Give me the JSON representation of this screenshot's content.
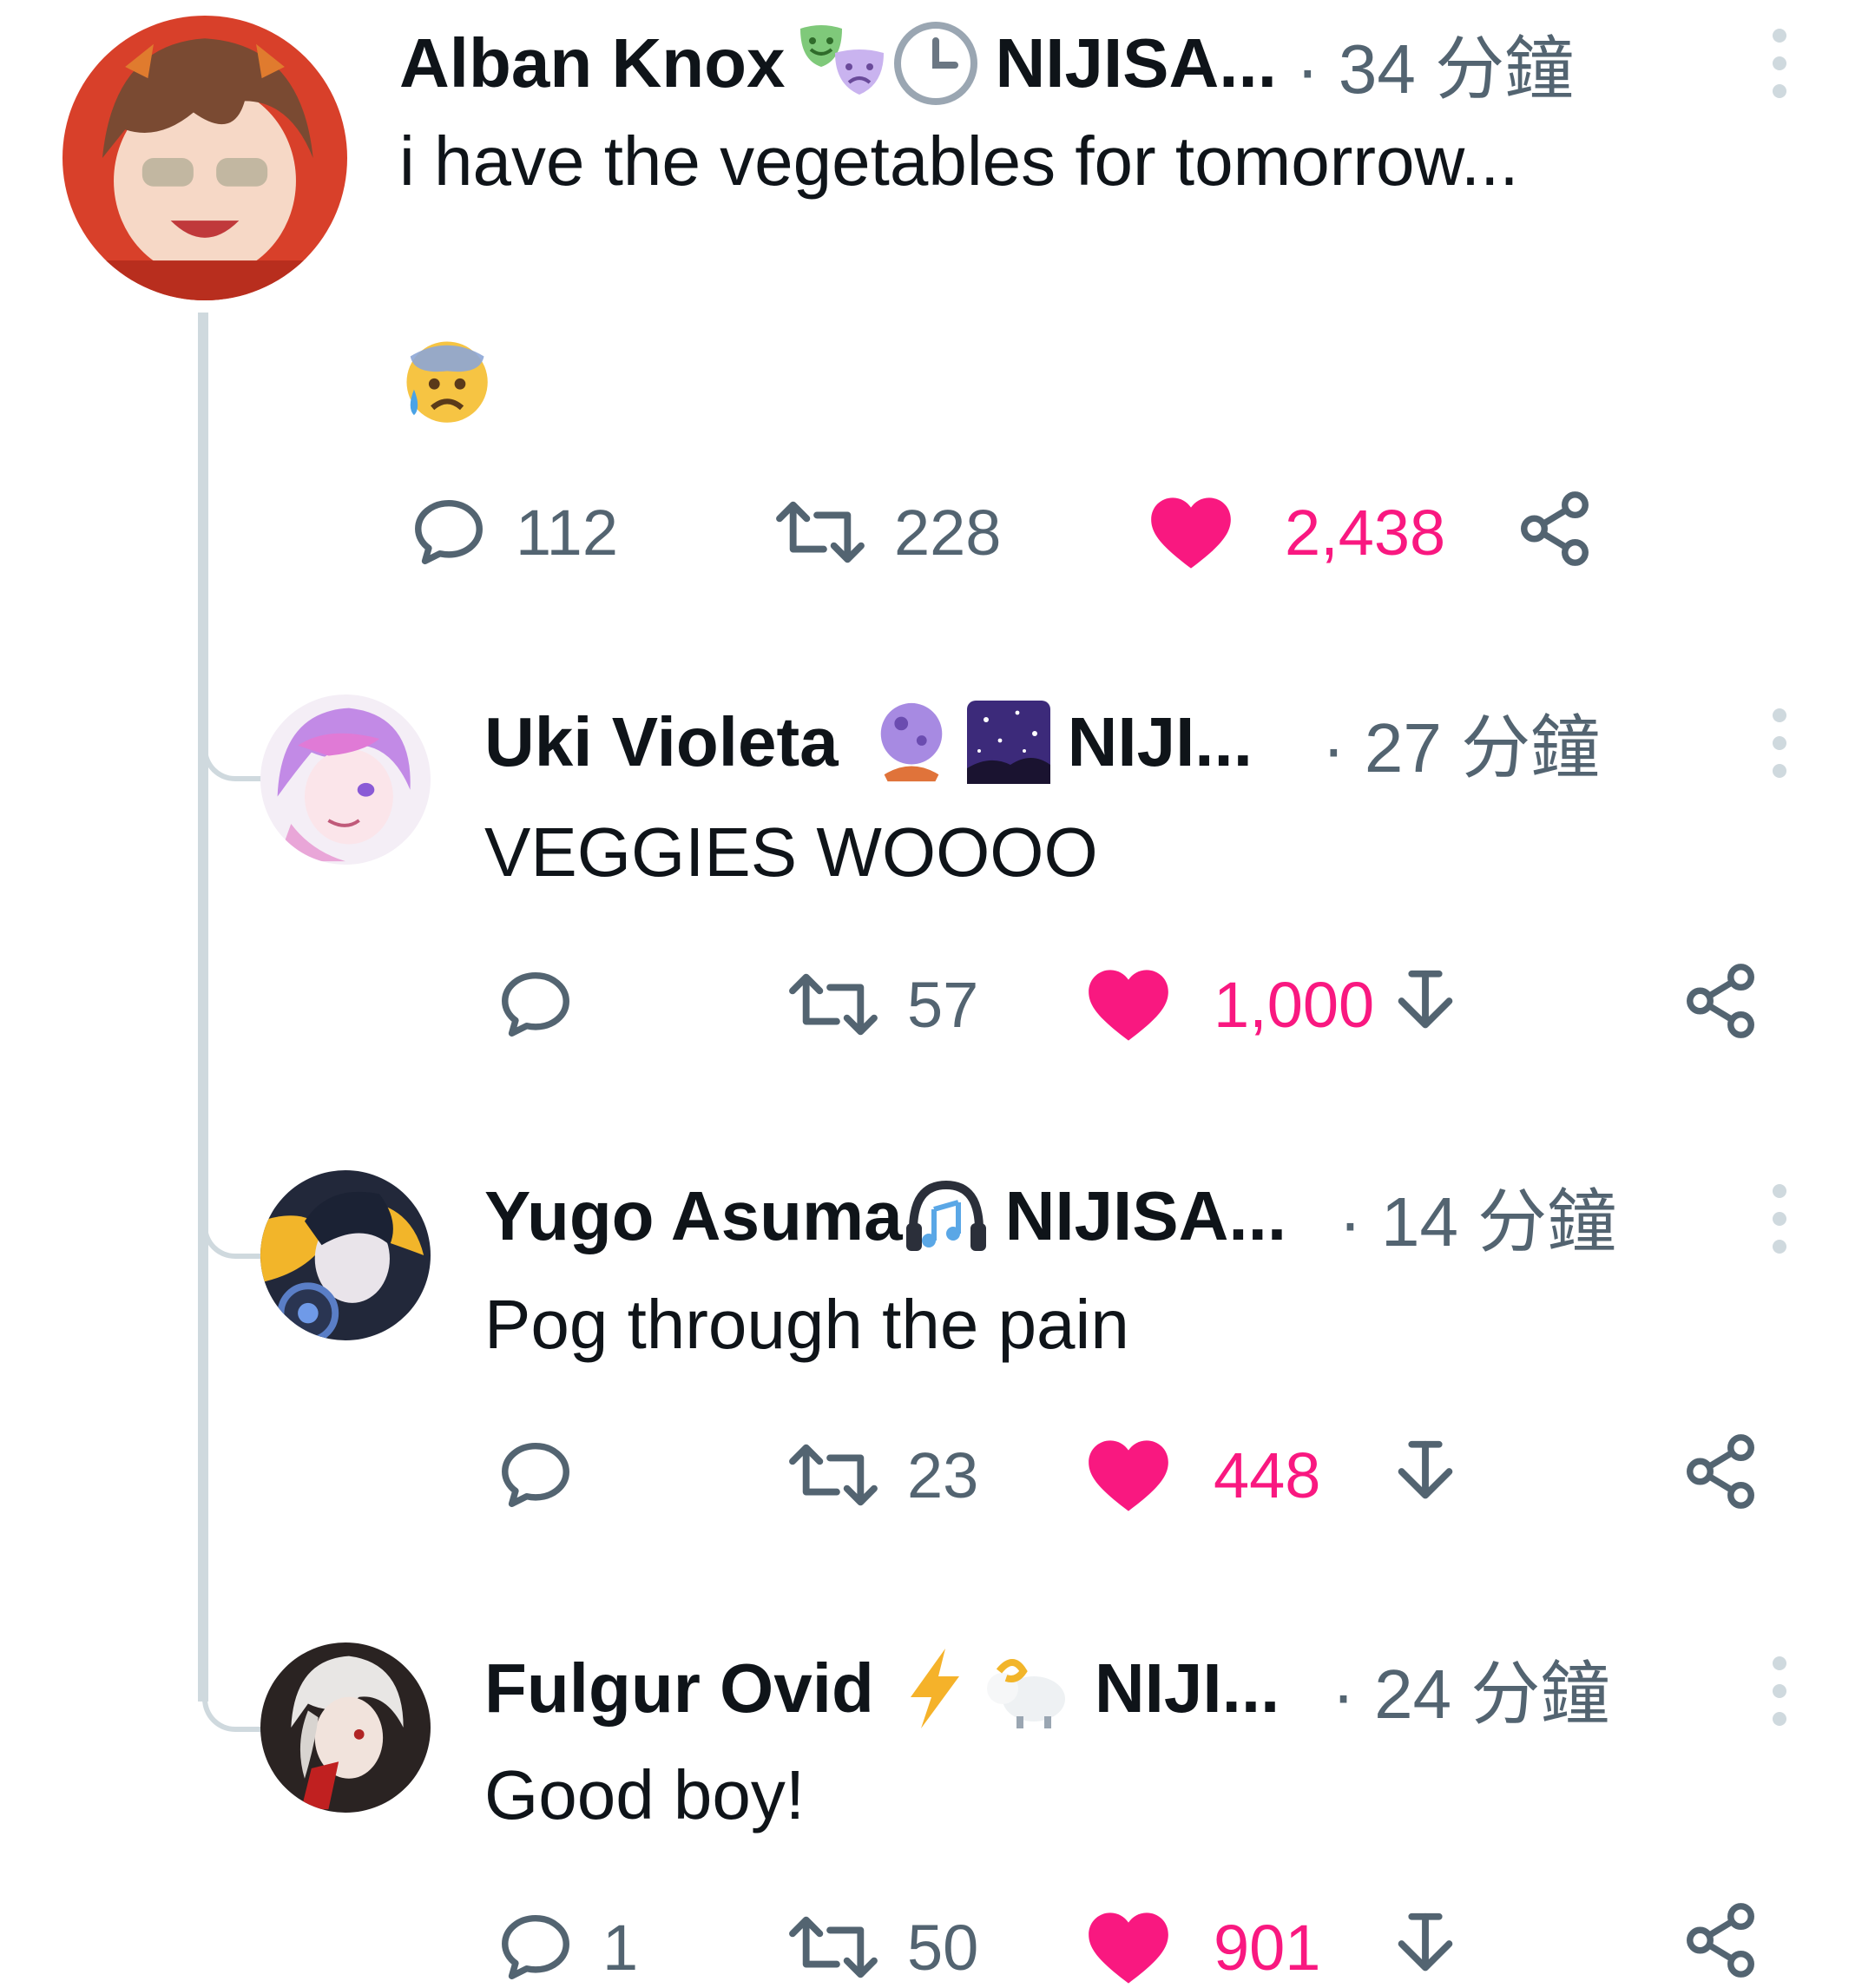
{
  "tweets": [
    {
      "name": "Alban Knox",
      "handle": "NIJISA...",
      "time": "· 34 分鐘",
      "text": "i have the vegetables for tomorrow...",
      "extra_emoji": "anxious-face-with-sweat",
      "badges": [
        "performing-arts-masks",
        "clock"
      ],
      "replies": "112",
      "retweets": "228",
      "likes": "2,438"
    },
    {
      "name": "Uki Violeta",
      "handle": "NIJI...",
      "time": "· 27 分鐘",
      "text": "VEGGIES WOOOO",
      "badges": [
        "crystal-ball",
        "night-sky"
      ],
      "replies": "",
      "retweets": "57",
      "likes": "1,000"
    },
    {
      "name": "Yugo Asuma",
      "handle": "NIJISA...",
      "time": "· 14 分鐘",
      "text": "Pog through the pain",
      "badges": [
        "headphone"
      ],
      "replies": "",
      "retweets": "23",
      "likes": "448"
    },
    {
      "name": "Fulgur Ovid",
      "handle": "NIJI...",
      "time": "· 24 分鐘",
      "text": "Good boy!",
      "badges": [
        "lightning",
        "ram"
      ],
      "replies": "1",
      "retweets": "50",
      "likes": "901"
    }
  ],
  "colors": {
    "like": "#f91880",
    "muted": "#536471",
    "text": "#0f1419",
    "thread_line": "#cfd9de"
  }
}
